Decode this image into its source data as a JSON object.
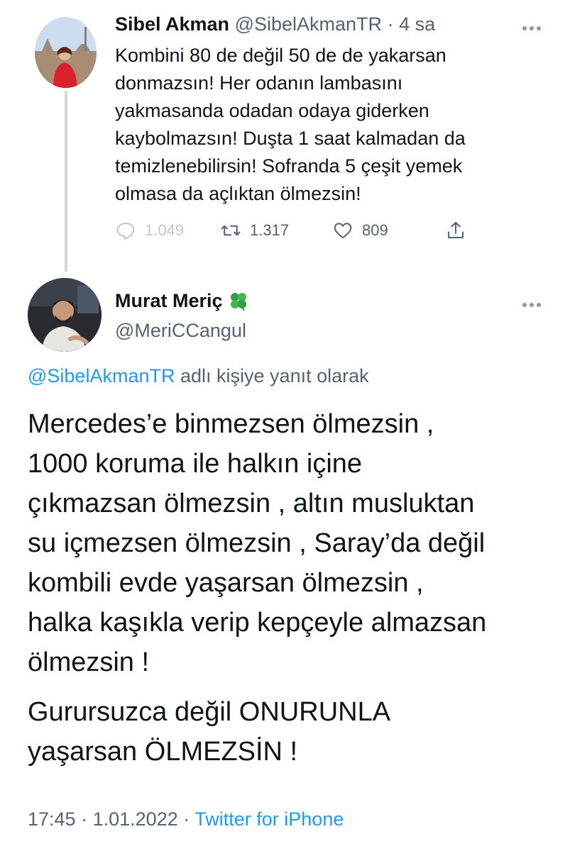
{
  "parent_tweet": {
    "author_name": "Sibel Akman",
    "author_handle": "@SibelAkmanTR",
    "separator": "·",
    "time": "4 sa",
    "text_lines": [
      "Kombini 80 de değil 50 de de yakarsan",
      "donmazsın! Her odanın lambasını",
      "yakmasanda odadan odaya giderken",
      "kaybolmazsın! Duşta 1 saat kalmadan da",
      "temizlenebilirsin! Sofranda 5 çeşit yemek",
      "olmasa da açlıktan ölmezsin!"
    ],
    "reply_count": "1.049",
    "retweet_count": "1.317",
    "like_count": "809"
  },
  "reply_tweet": {
    "author_name": "Murat Meriç",
    "author_handle": "@MeriCCangul",
    "replying_to": "@SibelAkmanTR",
    "replying_suffix": "adlı kişiye yanıt olarak",
    "paragraph1_lines": [
      "Mercedes’e binmezsen ölmezsin ,",
      "1000 koruma ile halkın içine",
      "çıkmazsan ölmezsin , altın musluktan",
      "su içmezsen ölmezsin , Saray’da değil",
      "kombili evde yaşarsan ölmezsin ,",
      "halka kaşıkla verip kepçeyle almazsan",
      "ölmezsin !"
    ],
    "paragraph2_lines": [
      "Gurursuzca değil ONURUNLA",
      "yaşarsan ÖLMEZSİN !"
    ],
    "time": "17:45",
    "date": "1.01.2022",
    "separator": "·",
    "source": "Twitter for iPhone"
  },
  "icons": {
    "more": "more-horizontal-icon",
    "reply": "reply-icon",
    "retweet": "retweet-icon",
    "like": "heart-icon",
    "share": "share-icon",
    "badge": "four-leaf-clover-icon"
  },
  "colors": {
    "link": "#1d9bf0",
    "secondary_text": "#536471",
    "thread_line": "#cfd9de"
  }
}
